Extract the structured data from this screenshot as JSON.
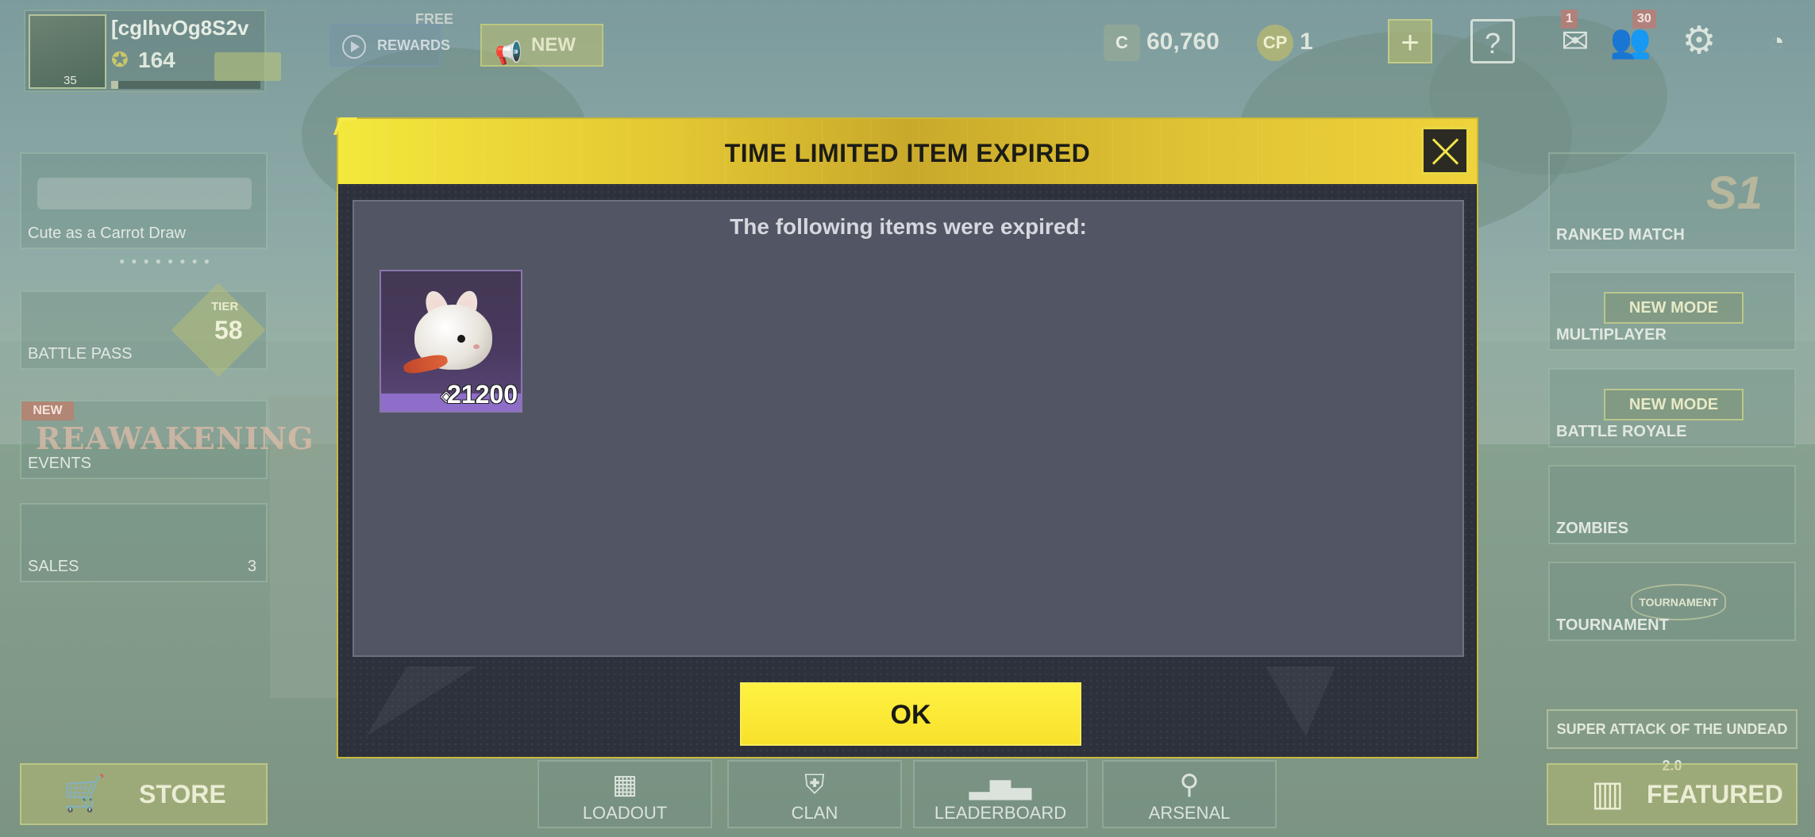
{
  "topbar": {
    "player_name": "[cglhvOg8S2v",
    "player_level": "164",
    "avatar_level": "35",
    "xp_progress": 0.05,
    "free_label": "FREE",
    "rewards_label": "REWARDS",
    "new_label": "NEW",
    "cod_points": "60,760",
    "credits": "1",
    "cp_label": "CP",
    "mail_count": "1",
    "friends_count": "30",
    "icons": [
      "plus-icon",
      "help-icon",
      "mail-icon",
      "friends-icon",
      "gear-icon",
      "power-icon"
    ]
  },
  "left_sidebar": {
    "weapon_label": "Cute as a Carrot Draw",
    "battle_pass_label": "BATTLE PASS",
    "tier_label": "TIER",
    "tier_value": "58",
    "events_ribbon": "NEW",
    "events_art_text": "REAWAKENING",
    "events_label": "EVENTS",
    "sales_label": "SALES",
    "sales_count": "3",
    "store_label": "STORE"
  },
  "right_sidebar": {
    "ranked_label": "RANKED MATCH",
    "season_mark": "S1",
    "multiplayer_label": "MULTIPLAYER",
    "multiplayer_badge": "NEW MODE",
    "battle_royale_label": "BATTLE ROYALE",
    "battle_royale_badge": "NEW MODE",
    "zombies_label": "ZOMBIES",
    "tournament_label": "TOURNAMENT",
    "tournament_badge": "TOURNAMENT",
    "event_banner": "SUPER ATTACK OF THE UNDEAD 2.0",
    "featured_label": "FEATURED"
  },
  "bottom_nav": {
    "loadout": "LOADOUT",
    "clan": "CLAN",
    "leaderboard": "LEADERBOARD",
    "arsenal": "ARSENAL"
  },
  "modal": {
    "title": "TIME LIMITED ITEM EXPIRED",
    "message": "The following items were expired:",
    "items": [
      {
        "icon": "bunny-icon",
        "count": "21200",
        "rarity_color": "#8e6ec8"
      }
    ],
    "ok_label": "OK"
  },
  "colors": {
    "accent_yellow": "#f8e12c",
    "modal_bg": "#2d313c",
    "panel_bg": "#525664",
    "rarity_epic": "#8e6ec8"
  }
}
